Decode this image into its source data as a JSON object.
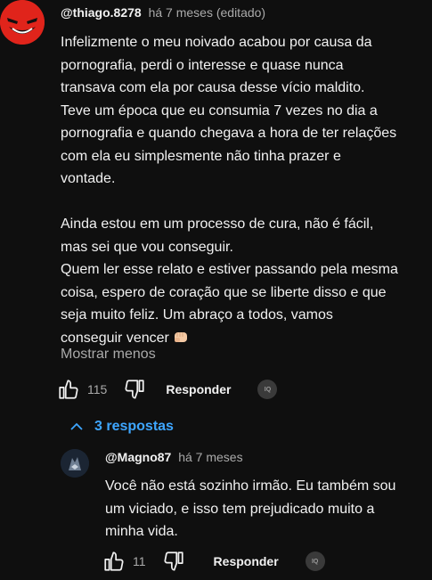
{
  "comment": {
    "author": "@thiago.8278",
    "meta": "há 7 meses (editado)",
    "paragraphs": [
      "Infelizmente o meu noivado acabou por causa da\npornografia, perdi o interesse e quase nunca\ntransava com ela por causa desse vício maldito.\nTeve um época que eu consumia 7 vezes no dia a\npornografia e quando chegava a hora de ter relações\ncom ela eu simplesmente não tinha prazer e\nvontade.",
      "Ainda estou em um processo de cura, não é fácil,\nmas sei que vou conseguir.\nQuem ler esse relato e estiver passando pela mesma\ncoisa,  espero de coração que se liberte disso e que\nseja muito feliz. Um abraço a todos, vamos\nconseguir vencer"
    ],
    "end_emoji": "fist-bump-emoji",
    "show_less": "Mostrar menos",
    "likes": "115",
    "reply_label": "Responder",
    "badge": "IQ"
  },
  "replies_toggle": {
    "label": "3 respostas",
    "icon": "chevron-up-icon",
    "color": "#3ea6ff"
  },
  "reply": {
    "author": "@Magno87",
    "meta": "há 7 meses",
    "text": "Você não está sozinho irmão. Eu também sou\num viciado, e isso tem prejudicado muito a\nminha vida.",
    "likes": "11",
    "reply_label": "Responder",
    "badge": "IQ"
  },
  "colors": {
    "background": "#0f0f0f",
    "text": "#f1f1f1",
    "secondary_text": "#aaaaaa",
    "avatar_red": "#e0241b"
  }
}
